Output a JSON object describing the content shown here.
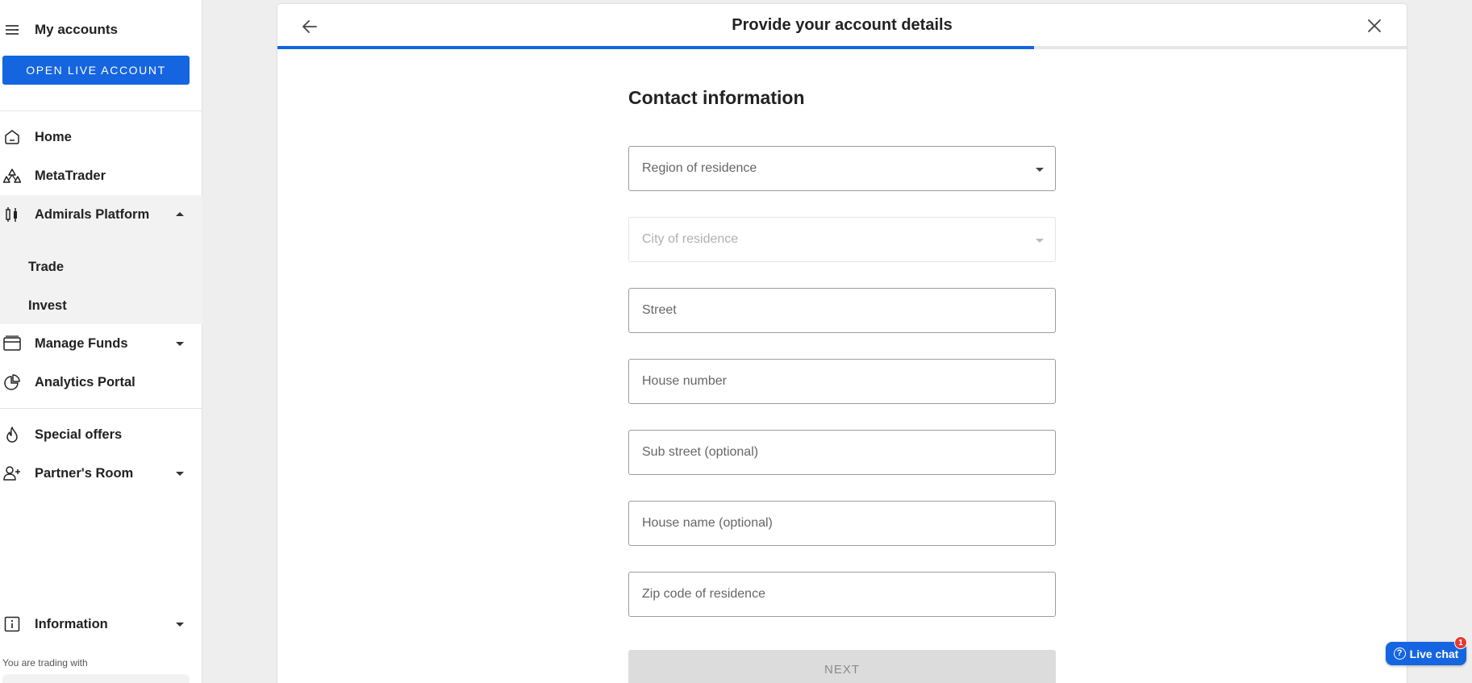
{
  "sidebar": {
    "title": "My accounts",
    "open_live_account": "OPEN LIVE ACCOUNT",
    "items": [
      {
        "label": "Home",
        "icon": "home-icon"
      },
      {
        "label": "MetaTrader",
        "icon": "metatrader-icon"
      },
      {
        "label": "Admirals Platform",
        "icon": "candlestick-icon",
        "expanded": true
      },
      {
        "label": "Manage Funds",
        "icon": "wallet-icon"
      },
      {
        "label": "Analytics Portal",
        "icon": "pie-chart-icon"
      },
      {
        "label": "Special offers",
        "icon": "flame-icon"
      },
      {
        "label": "Partner's Room",
        "icon": "add-user-icon"
      },
      {
        "label": "Information",
        "icon": "info-icon"
      }
    ],
    "subitems": [
      {
        "label": "Trade"
      },
      {
        "label": "Invest"
      }
    ],
    "trading_with": "You are trading with"
  },
  "modal": {
    "title": "Provide your account details",
    "progress": 0.67,
    "section_title": "Contact information",
    "fields": [
      {
        "label": "Region of residence",
        "type": "select",
        "disabled": false
      },
      {
        "label": "City of residence",
        "type": "select",
        "disabled": true
      },
      {
        "label": "Street",
        "type": "text",
        "disabled": false
      },
      {
        "label": "House number",
        "type": "text",
        "disabled": false
      },
      {
        "label": "Sub street (optional)",
        "type": "text",
        "disabled": false
      },
      {
        "label": "House name (optional)",
        "type": "text",
        "disabled": false
      },
      {
        "label": "Zip code of residence",
        "type": "text",
        "disabled": false
      }
    ],
    "next_label": "NEXT"
  },
  "live_chat": {
    "label": "Live chat",
    "badge": "1"
  },
  "colors": {
    "accent": "#1565e0",
    "badge": "#e53935"
  }
}
